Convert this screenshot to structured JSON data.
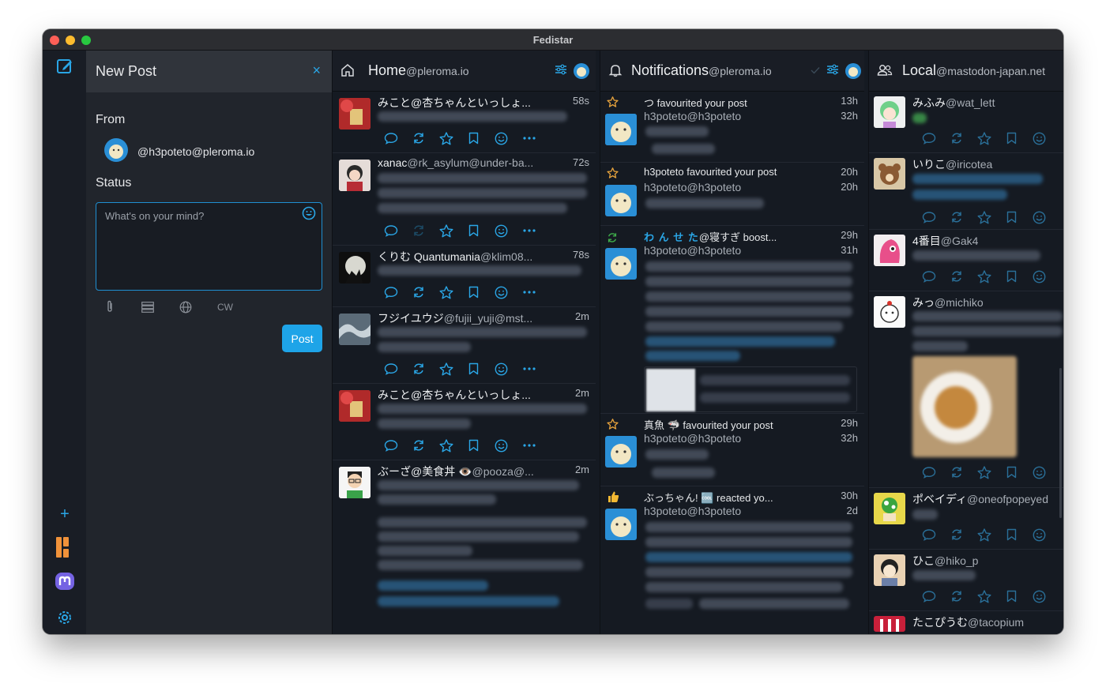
{
  "window": {
    "title": "Fedistar"
  },
  "rail": {
    "compose_icon": "compose-icon",
    "add_icon": "plus-icon",
    "pleroma_icon": "pleroma-logo",
    "mastodon_icon": "mastodon-logo",
    "settings_icon": "gear-icon"
  },
  "compose": {
    "title": "New Post",
    "close": "×",
    "from_label": "From",
    "from_handle": "@h3poteto@pleroma.io",
    "status_label": "Status",
    "status_placeholder": "What's on your mind?",
    "cw_label": "CW",
    "post_label": "Post",
    "tools": [
      "paperclip-icon",
      "poll-icon",
      "globe-icon"
    ]
  },
  "columns": {
    "home": {
      "title": "Home",
      "domain": "@pleroma.io"
    },
    "notifications": {
      "title": "Notifications",
      "domain": "@pleroma.io"
    },
    "local": {
      "title": "Local",
      "domain": "@mastodon-japan.net"
    }
  },
  "home_posts": [
    {
      "name": "みこと@杏ちゃんといっしょ...",
      "acct": "",
      "time": "58s"
    },
    {
      "name": "xanac",
      "acct": "@rk_asylum@under-ba...",
      "time": "72s"
    },
    {
      "name": "くりむ Quantumania",
      "acct": "@klim08...",
      "time": "78s"
    },
    {
      "name": "フジイユウジ",
      "acct": "@fujii_yuji@mst...",
      "time": "2m"
    },
    {
      "name": "みこと@杏ちゃんといっしょ...",
      "acct": "",
      "time": "2m"
    },
    {
      "name": "ぶーざ@美食丼 👁️",
      "acct": "@pooza@...",
      "time": "2m"
    }
  ],
  "notifications": [
    {
      "text": "つ favourited your post",
      "time": "13h",
      "acct": "h3poteto@h3poteto",
      "time2": "32h"
    },
    {
      "text": "h3poteto favourited your post",
      "time": "20h",
      "acct": "h3poteto@h3poteto",
      "time2": "20h"
    },
    {
      "text_styled": "わ ん せ た",
      "text": "@寝すぎ boost...",
      "time": "29h",
      "acct": "h3poteto@h3poteto",
      "time2": "31h"
    },
    {
      "text": "真魚 🦈 favourited your post",
      "time": "29h",
      "acct": "h3poteto@h3poteto",
      "time2": "32h"
    },
    {
      "text": "ぶっちゃん! 🆒 reacted yo...",
      "time": "30h",
      "acct": "h3poteto@h3poteto",
      "time2": "2d"
    }
  ],
  "local_posts": [
    {
      "name": "みふみ",
      "acct": "@wat_lett"
    },
    {
      "name": "いりこ",
      "acct": "@iricotea"
    },
    {
      "name": "4番目",
      "acct": "@Gak4"
    },
    {
      "name": "みっ",
      "acct": "@michiko"
    },
    {
      "name": "ポベイディ",
      "acct": "@oneofpopeyed"
    },
    {
      "name": "ひこ",
      "acct": "@hiko_p"
    },
    {
      "name": "たこぴうむ",
      "acct": "@tacopium"
    }
  ],
  "colors": {
    "accent": "#1ea4e8",
    "background": "#151a22",
    "panel": "#21252c",
    "favourite": "#e6a23c",
    "boost": "#3fae4b"
  }
}
